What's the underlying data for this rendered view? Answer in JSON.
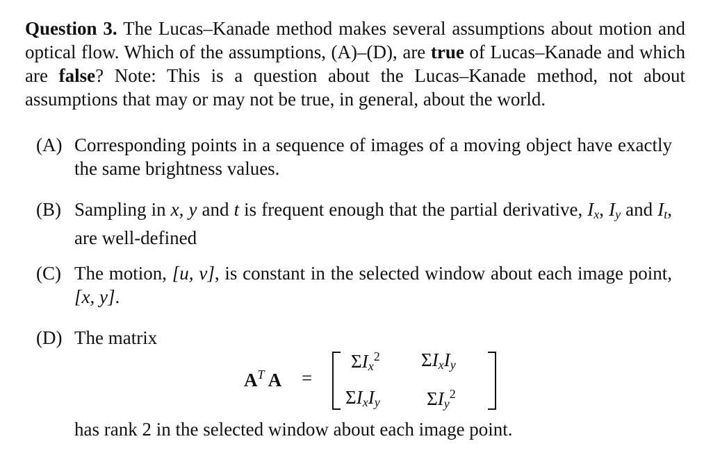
{
  "question": {
    "heading": "Question 3.",
    "intro": " The Lucas–Kanade method makes several assumptions about motion and optical flow. Which of the assumptions, (A)–(D), are ",
    "true_word": "true",
    "mid": " of Lucas–Kanade and which are ",
    "false_word": "false",
    "outro": "? Note: This is a question about the Lucas–Kanade method, not about assumptions that may or may not be true, in general, about the world."
  },
  "items": [
    {
      "label": "(A)",
      "text": "Corresponding points in a sequence of images of a moving object have exactly the same brightness values."
    },
    {
      "label": "(B)",
      "pre": "Sampling in ",
      "x": "x",
      "c1": ", ",
      "y": "y",
      "c2": " and ",
      "t": "t",
      "post": " is frequent enough that the partial derivative, ",
      "I": "I",
      "ix": "x",
      "c3": ", ",
      "iy": "y",
      "c4": " and ",
      "it": "t",
      "end": ", are well-defined"
    },
    {
      "label": "(C)",
      "pre": "The motion, ",
      "uv": "[u, v]",
      "mid": ", is constant in the selected window about each image point, ",
      "xy": "[x, y]",
      "end": "."
    },
    {
      "label": "(D)",
      "text": "The matrix"
    }
  ],
  "matrix": {
    "lhs": "A",
    "lhs_sup": "T",
    "lhs2": "A",
    "equals": "=",
    "sigma": "Σ",
    "I": "I",
    "x": "x",
    "y": "y",
    "two": "2"
  },
  "closing": "has rank 2 in the selected window about each image point."
}
